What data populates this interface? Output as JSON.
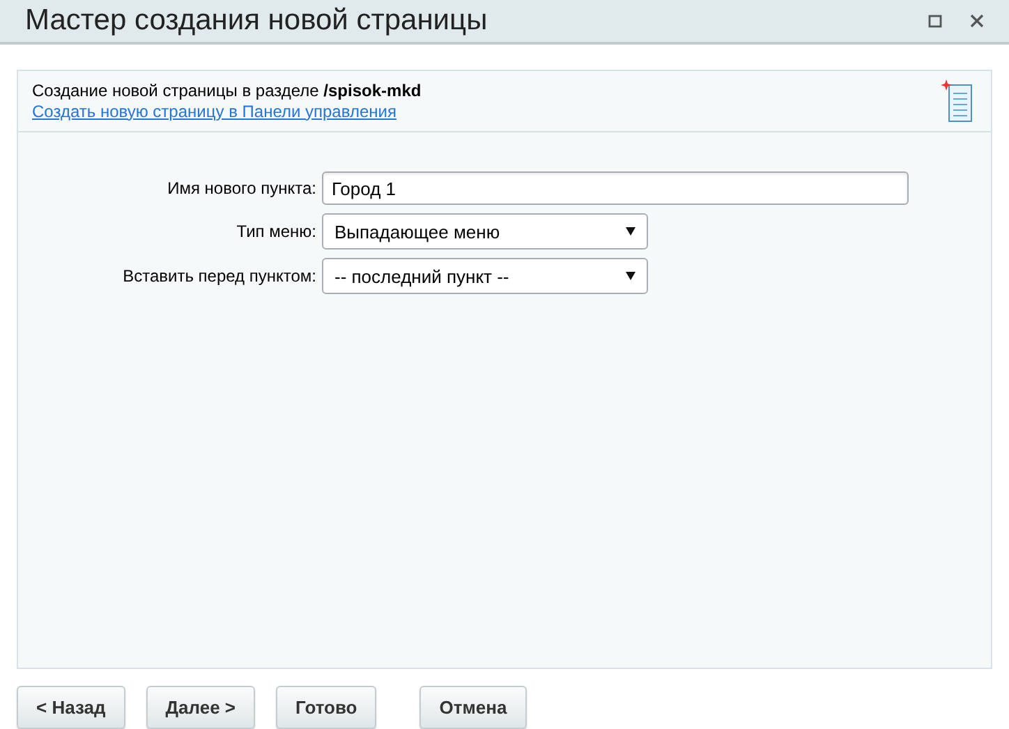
{
  "window": {
    "title": "Мастер создания новой страницы"
  },
  "header": {
    "text": "Создание новой страницы в разделе **/spisok-mkd**",
    "link": "Создать новую страницу в Панели управления"
  },
  "fields": [
    {
      "kind": "text",
      "label": "Имя нового пункта:",
      "value": "Город 1"
    },
    {
      "kind": "select",
      "label": "Тип меню:",
      "value": "Выпадающее меню"
    },
    {
      "kind": "select",
      "label": "Вставить перед пунктом:",
      "value": "-- последний пункт --"
    }
  ],
  "buttons": [
    "< Назад",
    "Далее >",
    "Готово",
    "Отмена"
  ]
}
